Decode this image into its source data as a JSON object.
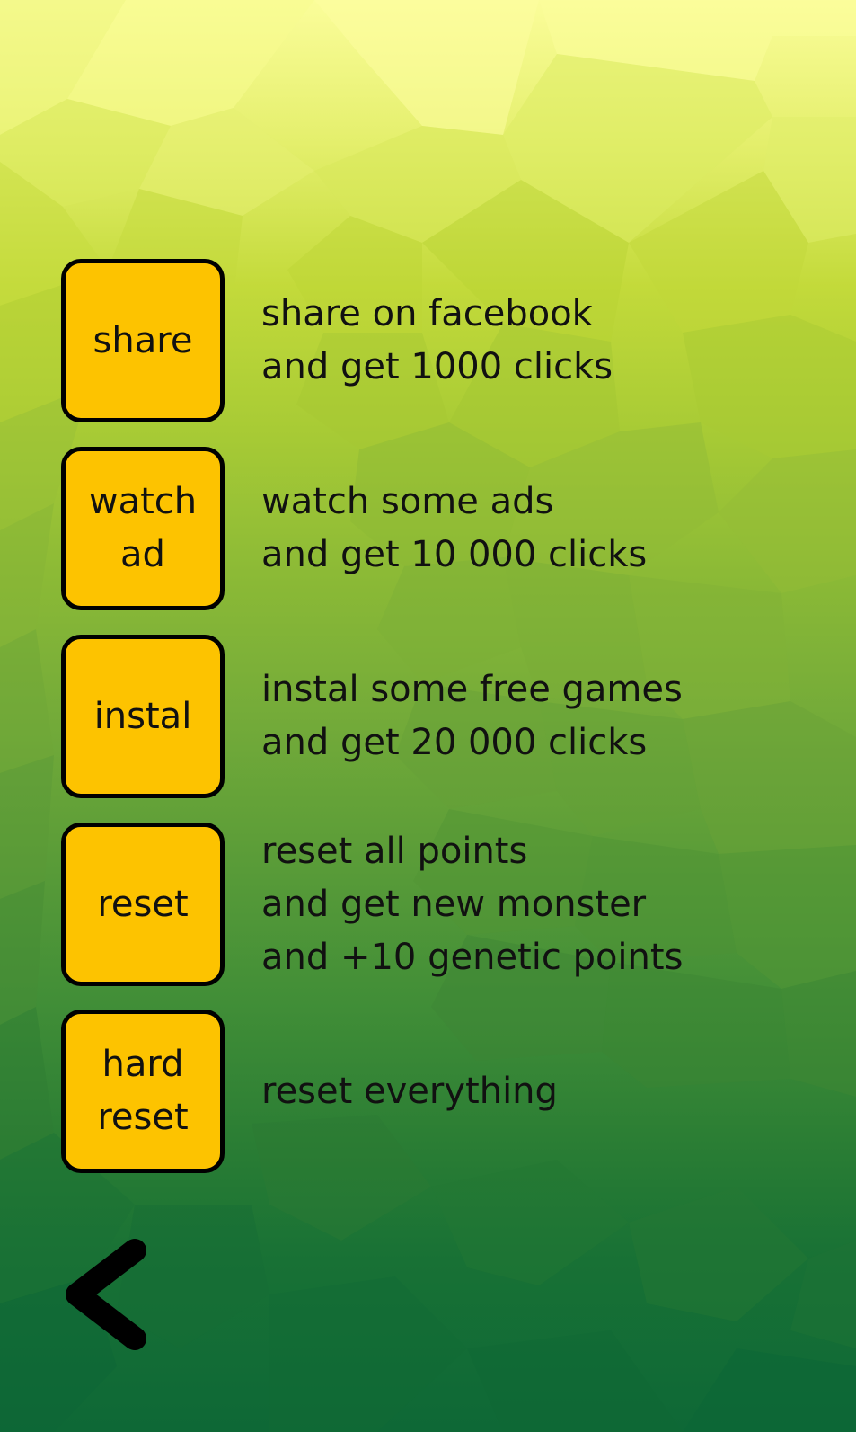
{
  "options": [
    {
      "button": "share",
      "desc": [
        "share on facebook",
        "and get 1000 clicks"
      ]
    },
    {
      "button": "watch\nad",
      "desc": [
        "watch some ads",
        "and get 10 000 clicks"
      ]
    },
    {
      "button": "instal",
      "desc": [
        "instal some free games",
        "and get 20 000 clicks"
      ]
    },
    {
      "button": "reset",
      "desc": [
        "reset all points",
        "and get new monster",
        "and +10 genetic points"
      ]
    },
    {
      "button": "hard\nreset",
      "desc": [
        "reset everything"
      ]
    }
  ],
  "back_icon": "chevron-left-icon",
  "colors": {
    "button_fill": "#fdc300",
    "button_border": "#000000",
    "text": "#111111",
    "bg_top": "#fbfd9a",
    "bg_bottom": "#0e6836"
  }
}
